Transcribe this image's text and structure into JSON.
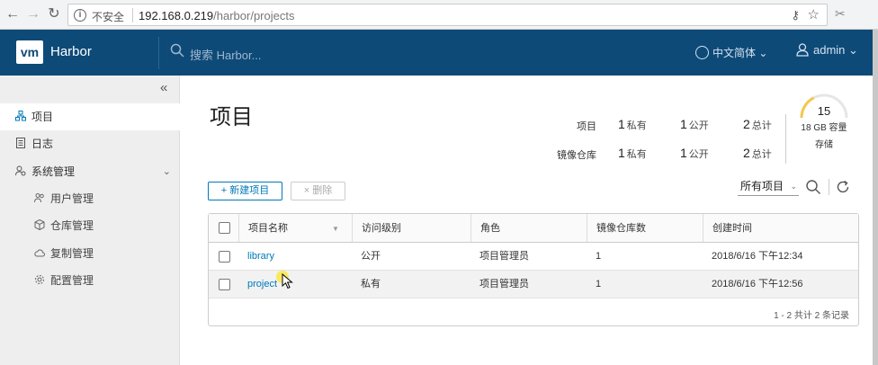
{
  "browser": {
    "insecure_label": "不安全",
    "url_host": "192.168.0.219",
    "url_path": "/harbor/projects"
  },
  "header": {
    "logo_text": "vm",
    "brand": "Harbor",
    "search_placeholder": "搜索 Harbor...",
    "language": "中文简体",
    "user": "admin",
    "color": "#0d4a78"
  },
  "sidebar": {
    "items": [
      {
        "label": "项目"
      },
      {
        "label": "日志"
      },
      {
        "label": "系统管理"
      }
    ],
    "subitems": [
      {
        "label": "用户管理"
      },
      {
        "label": "仓库管理"
      },
      {
        "label": "复制管理"
      },
      {
        "label": "配置管理"
      }
    ]
  },
  "main": {
    "title": "项目",
    "stats": {
      "projects_label": "项目",
      "repos_label": "镜像仓库",
      "private_unit": "私有",
      "public_unit": "公开",
      "total_unit": "总计",
      "projects_private": "1",
      "projects_public": "1",
      "projects_total": "2",
      "repos_private": "1",
      "repos_public": "1",
      "repos_total": "2"
    },
    "quota": {
      "count": "15",
      "capacity": "18 GB 容量",
      "storage": "存储",
      "fill_fraction": 0.35
    },
    "new_button": "+ 新建项目",
    "delete_button": "× 删除",
    "filter_value": "所有项目"
  },
  "table": {
    "columns": [
      "项目名称",
      "访问级别",
      "角色",
      "镜像仓库数",
      "创建时间"
    ],
    "rows": [
      {
        "name": "library",
        "access": "公开",
        "role": "项目管理员",
        "repos": "1",
        "created": "2018/6/16 下午12:34"
      },
      {
        "name": "project",
        "access": "私有",
        "role": "项目管理员",
        "repos": "1",
        "created": "2018/6/16 下午12:56"
      }
    ],
    "footer": "1 - 2 共计 2 条记录"
  }
}
